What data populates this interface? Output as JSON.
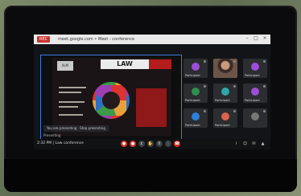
{
  "window": {
    "app_badge": "REC",
    "title": "meet.google.com • Meet - conference",
    "controls": [
      "–",
      "□",
      "×"
    ]
  },
  "slide": {
    "logo_text": "IILM",
    "title": "LAW",
    "caption": "You are presenting · Stop presenting",
    "presenter": "Presenting"
  },
  "participants": [
    {
      "name": "Participant",
      "color": "#9c4fd6",
      "photo": false
    },
    {
      "name": "",
      "color": "",
      "photo": true
    },
    {
      "name": "Participant",
      "color": "#9c4fd6",
      "photo": false
    },
    {
      "name": "Participant",
      "color": "#2f8f4e",
      "photo": false
    },
    {
      "name": "Participant",
      "color": "#2fa6a6",
      "photo": false
    },
    {
      "name": "Participant",
      "color": "#9c4fd6",
      "photo": false
    },
    {
      "name": "Participant",
      "color": "#2f7fd6",
      "photo": false
    },
    {
      "name": "Participant",
      "color": "#d9644a",
      "photo": false
    },
    {
      "name": "",
      "color": "#777",
      "photo": false
    }
  ],
  "bottombar": {
    "meeting_info": "2:32 PM | Law conference",
    "controls": [
      {
        "icon": "mic-off-icon",
        "glyph": "●",
        "red": true
      },
      {
        "icon": "camera-off-icon",
        "glyph": "●",
        "red": true
      },
      {
        "icon": "captions-icon",
        "glyph": "c",
        "red": false
      },
      {
        "icon": "hand-icon",
        "glyph": "✋",
        "red": false
      },
      {
        "icon": "present-icon",
        "glyph": "⇧",
        "red": false
      },
      {
        "icon": "more-icon",
        "glyph": "⋮",
        "red": false
      },
      {
        "icon": "end-call-icon",
        "glyph": "☎",
        "red": true
      }
    ],
    "right_controls": [
      {
        "icon": "info-icon",
        "glyph": "i"
      },
      {
        "icon": "people-icon",
        "glyph": "☺"
      },
      {
        "icon": "chat-icon",
        "glyph": "✉"
      },
      {
        "icon": "activities-icon",
        "glyph": "▲"
      }
    ]
  }
}
